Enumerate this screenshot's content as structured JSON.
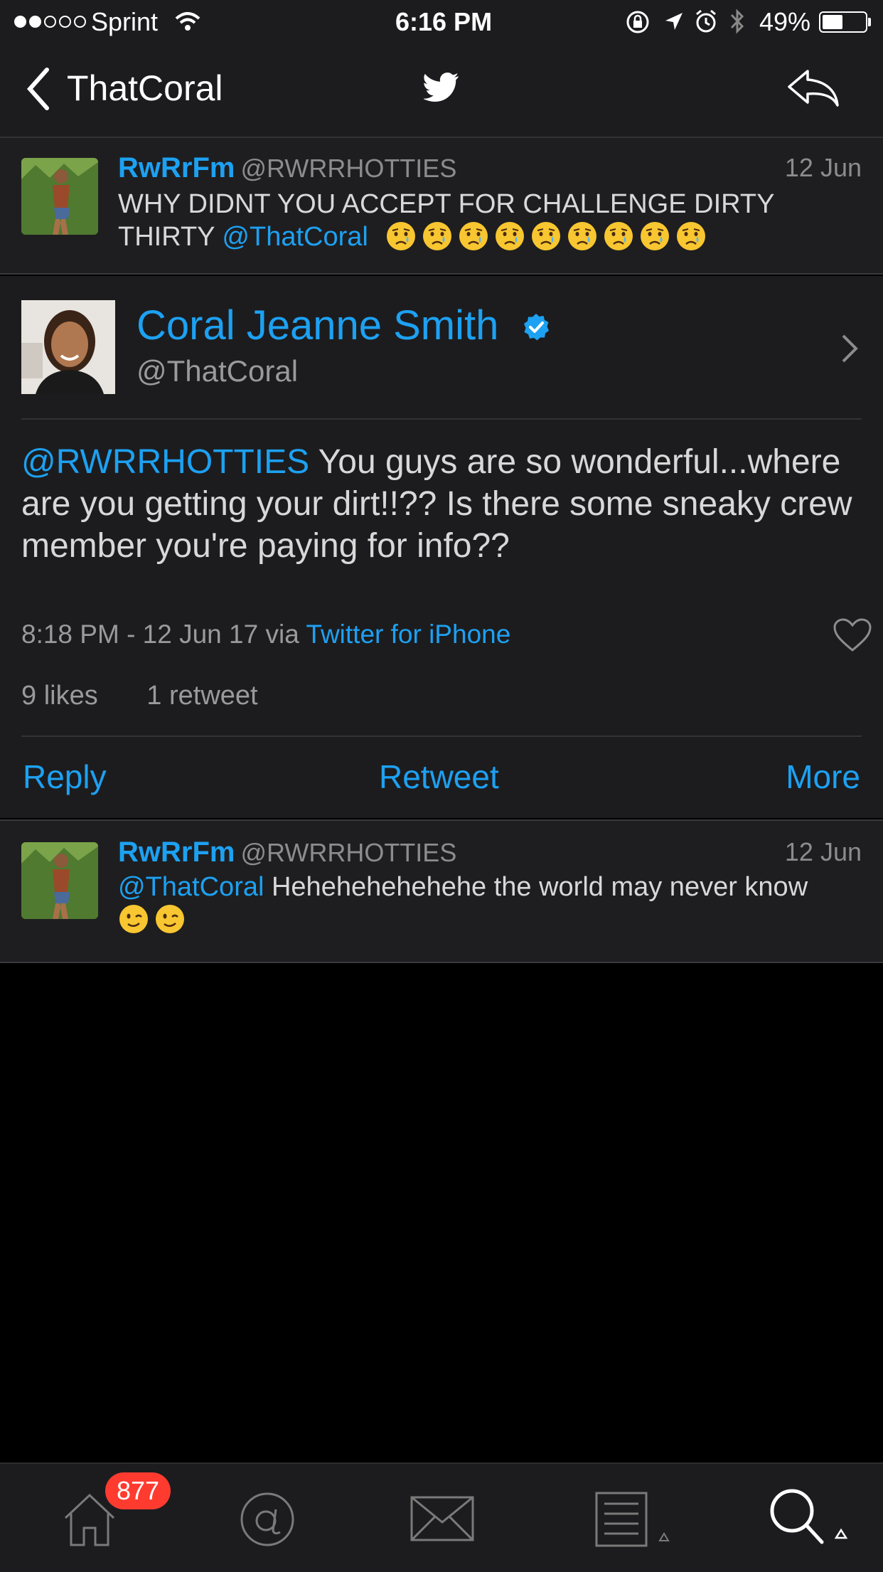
{
  "status_bar": {
    "carrier": "Sprint",
    "time": "6:16 PM",
    "battery_percent": "49%",
    "battery_level": 0.49,
    "signal_bars_filled": 2,
    "signal_bars_total": 5
  },
  "nav": {
    "back_label": "ThatCoral",
    "center_icon": "twitter-bird-icon",
    "right_icon": "reply-arrow-icon"
  },
  "parent_tweet": {
    "display_name": "RwRrFm",
    "handle": "@RWRRHOTTIES",
    "date": "12 Jun",
    "text": "WHY DIDNT YOU ACCEPT FOR CHALLENGE DIRTY THIRTY",
    "mention": "@ThatCoral",
    "emoji_count": 9,
    "emoji_name": "crying-face"
  },
  "main_tweet": {
    "display_name": "Coral Jeanne Smith",
    "verified": true,
    "handle": "@ThatCoral",
    "mention": "@RWRRHOTTIES",
    "text": " You guys are so wonderful...where are you getting your dirt!!?? Is there some sneaky crew member you're paying for info??",
    "timestamp": "8:18 PM - 12 Jun 17 via ",
    "source": "Twitter for iPhone",
    "likes": "9 likes",
    "retweets": "1 retweet",
    "actions": {
      "reply": "Reply",
      "retweet": "Retweet",
      "more": "More"
    }
  },
  "reply_tweet": {
    "display_name": "RwRrFm",
    "handle": "@RWRRHOTTIES",
    "date": "12 Jun",
    "mention": "@ThatCoral",
    "text": " Hehehehehehehe the world may never know",
    "emoji_count": 2,
    "emoji_name": "winking-face"
  },
  "tab_bar": {
    "home_badge": "877",
    "tabs": [
      "home-icon",
      "mentions-icon",
      "messages-icon",
      "lists-icon",
      "search-icon"
    ]
  },
  "colors": {
    "accent": "#1da1f2",
    "background": "#000000",
    "panel": "#1c1c1e",
    "badge": "#ff3b30"
  }
}
